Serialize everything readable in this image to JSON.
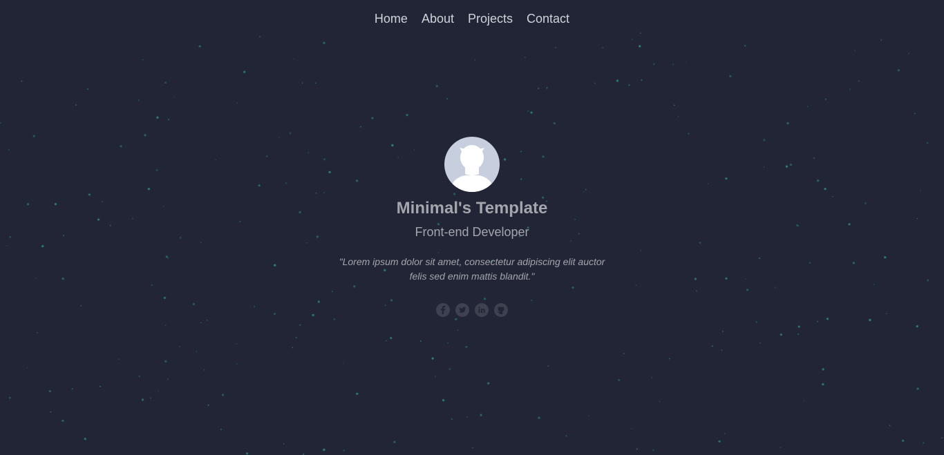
{
  "nav": {
    "items": [
      {
        "label": "Home"
      },
      {
        "label": "About"
      },
      {
        "label": "Projects"
      },
      {
        "label": "Contact"
      }
    ]
  },
  "profile": {
    "name": "Minimal's Template",
    "role": "Front-end Developer",
    "quote": "\"Lorem ipsum dolor sit amet, consectetur adipiscing elit auctor felis sed enim mattis blandit.\""
  },
  "social": {
    "icons": [
      "facebook-icon",
      "twitter-icon",
      "linkedin-icon",
      "github-icon"
    ]
  },
  "colors": {
    "background": "#212535",
    "nav_text": "#cfd3da",
    "text": "#a3a6ac",
    "avatar_bg": "#c7cedd",
    "star": "#3aa7a3",
    "social_icon_bg": "#3d4150"
  }
}
